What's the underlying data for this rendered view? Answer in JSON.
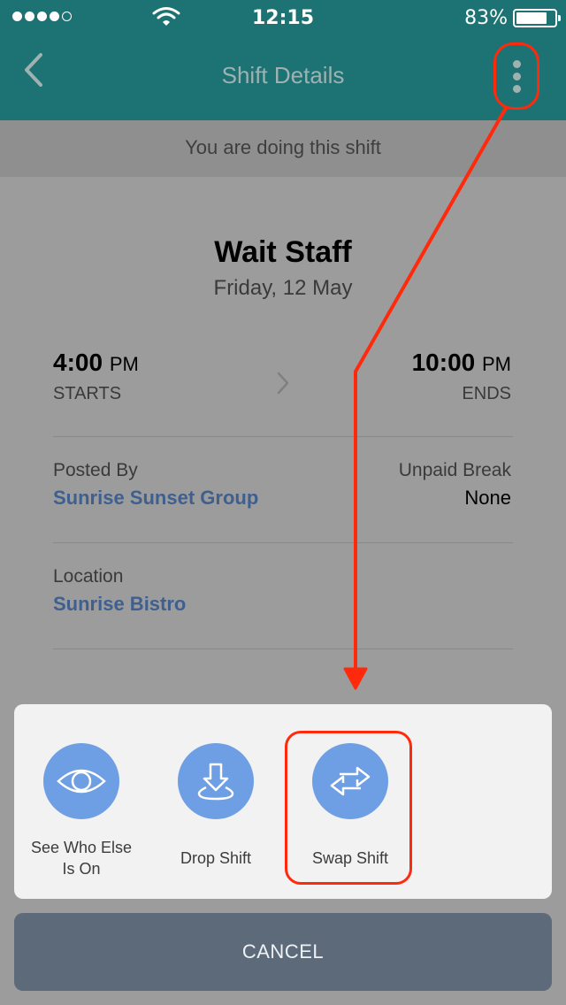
{
  "status_bar": {
    "time": "12:15",
    "battery": "83%"
  },
  "nav": {
    "title": "Shift Details"
  },
  "banner": {
    "text": "You are doing this shift"
  },
  "shift": {
    "role": "Wait Staff",
    "date": "Friday, 12 May",
    "start": {
      "time": "4:00",
      "unit": "PM",
      "label": "STARTS"
    },
    "end": {
      "time": "10:00",
      "unit": "PM",
      "label": "ENDS"
    },
    "posted_by": {
      "label": "Posted By",
      "value": "Sunrise Sunset Group"
    },
    "unpaid_break": {
      "label": "Unpaid Break",
      "value": "None"
    },
    "location": {
      "label": "Location",
      "value": "Sunrise Bistro"
    }
  },
  "actions": {
    "see_who": "See Who Else Is On",
    "drop": "Drop Shift",
    "swap": "Swap Shift",
    "cancel": "CANCEL"
  },
  "colors": {
    "header": "#1d7373",
    "action_icon": "#6e9ee3",
    "cancel_bg": "#5c6a79",
    "annotation": "#ff2a0c"
  },
  "icons": {
    "back": "chevron-left-icon",
    "more": "more-vertical-icon",
    "see_who": "eye-icon",
    "drop": "drop-down-arrow-icon",
    "swap": "swap-arrows-icon"
  }
}
